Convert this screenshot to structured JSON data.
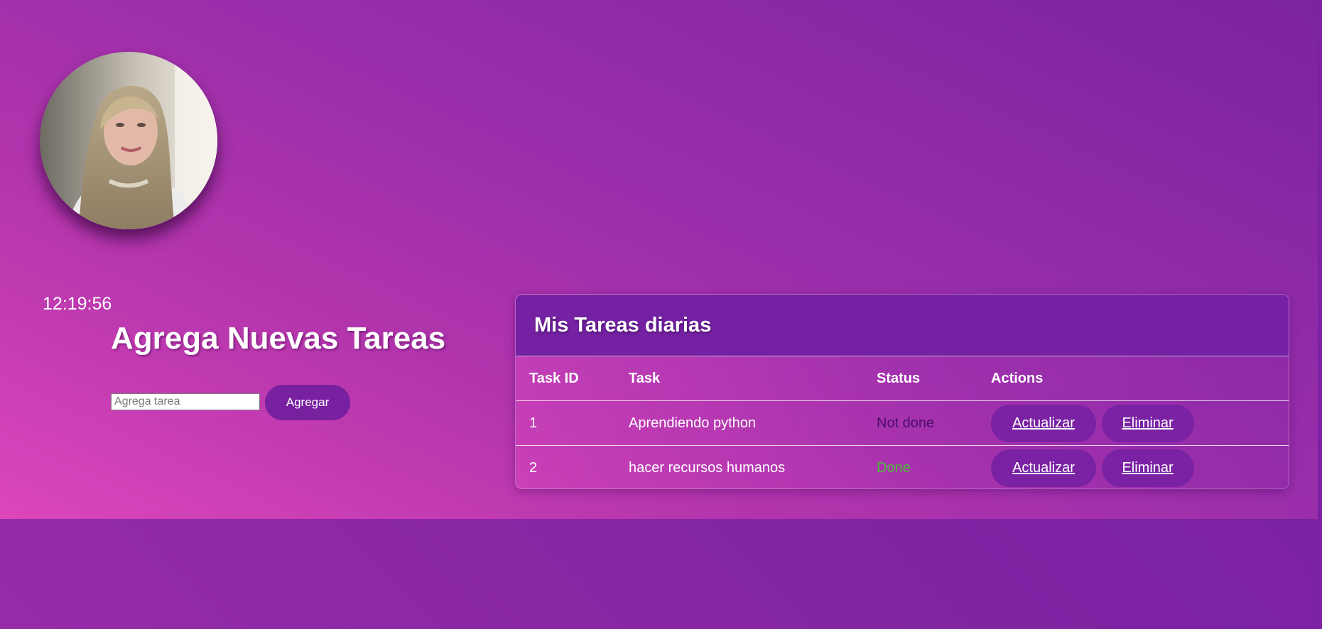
{
  "clock": {
    "time": "12:19:56"
  },
  "form": {
    "title": "Agrega Nuevas Tareas",
    "input_placeholder": "Agrega tarea",
    "input_value": "",
    "add_label": "Agregar"
  },
  "tasks_card": {
    "title": "Mis Tareas diarias",
    "columns": [
      "Task ID",
      "Task",
      "Status",
      "Actions"
    ],
    "rows": [
      {
        "id": "1",
        "task": "Aprendiendo python",
        "status": "Not done",
        "update_label": "Actualizar",
        "delete_label": "Eliminar"
      },
      {
        "id": "2",
        "task": "hacer recursos humanos",
        "status": "Done",
        "update_label": "Actualizar",
        "delete_label": "Eliminar"
      }
    ]
  },
  "colors": {
    "gradient_pink": "#dc46bb",
    "gradient_purple": "#7720a1",
    "button_purple": "#7720a0",
    "status_done": "#4cbb38",
    "status_not_done": "#4a0f6a"
  },
  "icons": {
    "avatar": "profile-photo"
  }
}
